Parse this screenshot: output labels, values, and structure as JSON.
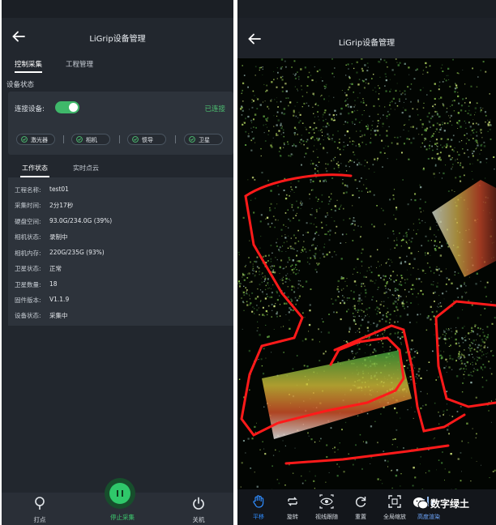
{
  "left": {
    "title": "LiGrip设备管理",
    "tabs": [
      "控制采集",
      "工程管理"
    ],
    "section_title": "设备状态",
    "connect_label": "连接设备:",
    "connect_status": "已连接",
    "chips": [
      "激光器",
      "相机",
      "惯导",
      "卫星"
    ],
    "subtabs": [
      "工作状态",
      "实时点云"
    ],
    "rows": [
      {
        "label": "工程名称:",
        "value": "test01"
      },
      {
        "label": "采集时间:",
        "value": "2分17秒"
      },
      {
        "label": "硬盘空间:",
        "value": "93.0G/234.0G (39%)"
      },
      {
        "label": "相机状态:",
        "value": "录制中"
      },
      {
        "label": "相机内存:",
        "value": "220G/235G (93%)"
      },
      {
        "label": "卫星状态:",
        "value": "正常"
      },
      {
        "label": "卫星数量:",
        "value": "18"
      },
      {
        "label": "固件版本:",
        "value": "V1.1.9"
      },
      {
        "label": "设备状态:",
        "value": "采集中"
      }
    ],
    "bottom": {
      "left": "打点",
      "center": "停止采集",
      "right": "关机"
    }
  },
  "right": {
    "title": "LiGrip设备管理",
    "tools": [
      "平移",
      "旋转",
      "视线跟随",
      "重置",
      "全局缩放",
      "高度渲染"
    ],
    "active_tool": "平移",
    "watermark": "数字绿土"
  },
  "colors": {
    "accent_green": "#3fb86a",
    "accent_blue": "#2f8cff",
    "boundary_red": "#ff1a1a"
  }
}
